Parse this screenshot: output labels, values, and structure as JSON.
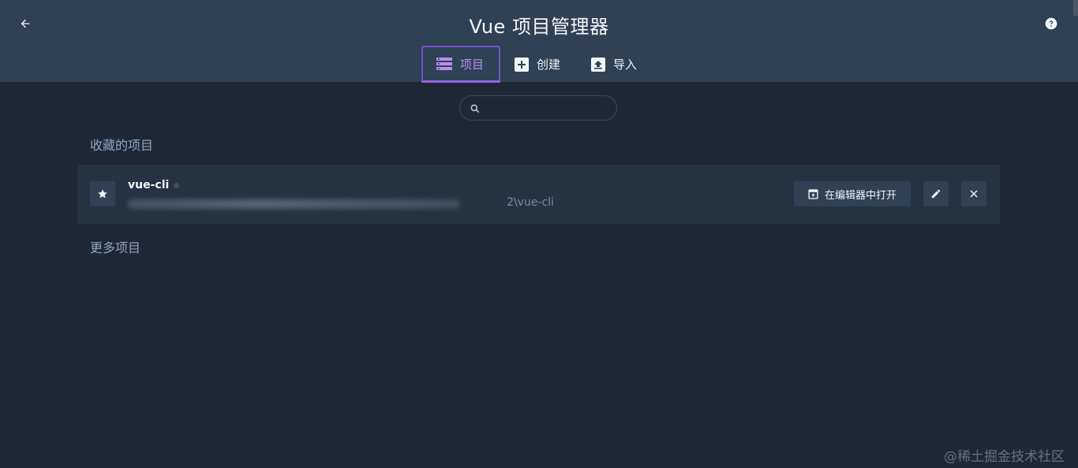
{
  "header": {
    "title": "Vue 项目管理器",
    "back_icon": "arrow-left-icon",
    "help_icon": "help-circle-icon"
  },
  "tabs": [
    {
      "label": "项目",
      "icon": "list-icon",
      "active": true
    },
    {
      "label": "创建",
      "icon": "add-box-icon",
      "active": false
    },
    {
      "label": "导入",
      "icon": "upload-icon",
      "active": false
    }
  ],
  "search": {
    "placeholder": "",
    "value": ""
  },
  "favorites": {
    "title": "收藏的项目",
    "projects": [
      {
        "name": "vue-cli",
        "path_suffix": "2\\vue-cli",
        "open_in_editor_label": "在编辑器中打开"
      }
    ]
  },
  "more": {
    "title": "更多项目"
  },
  "watermark": "@稀土掘金技术社区",
  "colors": {
    "background": "#1e2837",
    "header": "#2f4155",
    "accent": "#9766e3",
    "section_title": "#8ba4c4"
  }
}
